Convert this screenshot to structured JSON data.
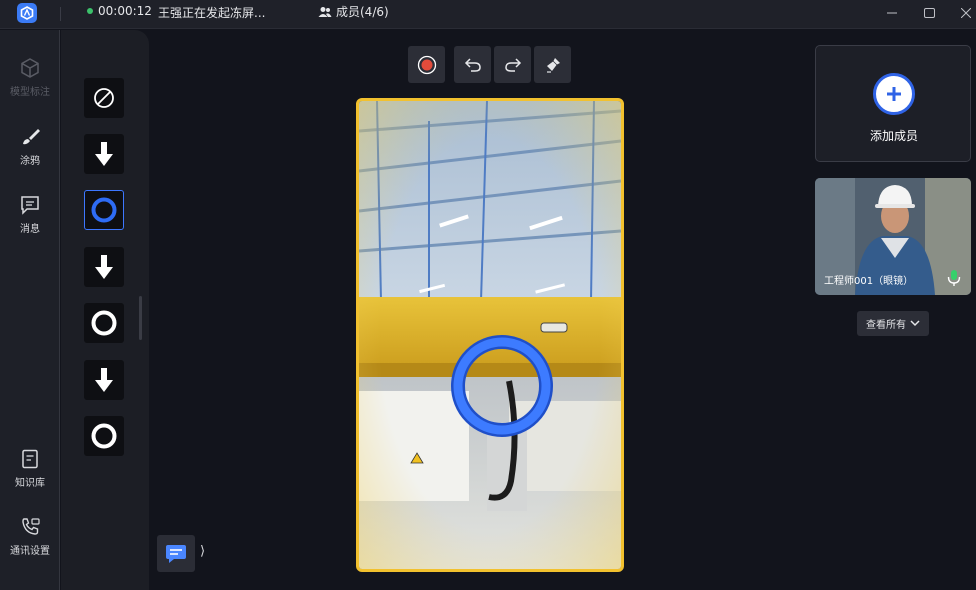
{
  "titlebar": {
    "timer": "00:00:12",
    "notice": "王强正在发起冻屏...",
    "members": "成员(4/6)",
    "status_color": "#3cc16b"
  },
  "leftnav": {
    "items": [
      {
        "label": "模型标注",
        "icon": "cube-icon",
        "enabled": false
      },
      {
        "label": "涂鸦",
        "icon": "brush-icon",
        "enabled": true
      },
      {
        "label": "消息",
        "icon": "message-icon",
        "enabled": true
      },
      {
        "label": "知识库",
        "icon": "book-icon",
        "enabled": true
      },
      {
        "label": "通讯设置",
        "icon": "phone-settings-icon",
        "enabled": true
      }
    ]
  },
  "tools": [
    {
      "icon": "none-icon"
    },
    {
      "icon": "arrow-down-icon"
    },
    {
      "icon": "circle-icon",
      "selected": true,
      "color": "#2e6cf5"
    },
    {
      "icon": "arrow-down-icon"
    },
    {
      "icon": "circle-icon"
    },
    {
      "icon": "arrow-down-icon"
    },
    {
      "icon": "circle-icon"
    }
  ],
  "toolbar": {
    "record_color": "#e24b3b",
    "icons": [
      "record-icon",
      "undo-icon",
      "redo-icon",
      "clear-icon"
    ]
  },
  "frame_color": "#f2c12e",
  "right": {
    "add_label": "添加成员",
    "member_name": "工程师001（眼镜）",
    "viewall_label": "查看所有"
  }
}
